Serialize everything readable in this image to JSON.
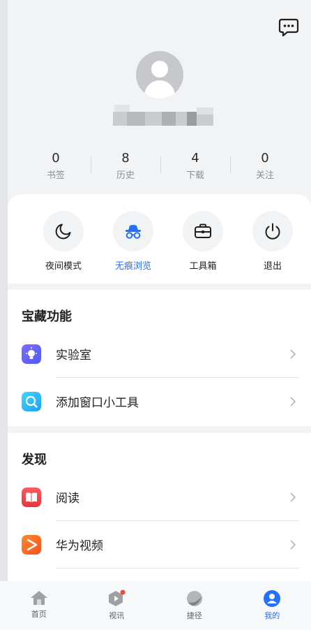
{
  "profile": {
    "stats": [
      {
        "value": "0",
        "label": "书签"
      },
      {
        "value": "8",
        "label": "历史"
      },
      {
        "value": "4",
        "label": "下载"
      },
      {
        "value": "0",
        "label": "关注"
      }
    ]
  },
  "quick_actions": [
    {
      "label": "夜间模式",
      "icon": "moon-icon"
    },
    {
      "label": "无痕浏览",
      "icon": "incognito-icon",
      "active": true
    },
    {
      "label": "工具箱",
      "icon": "toolbox-icon"
    },
    {
      "label": "退出",
      "icon": "power-icon"
    }
  ],
  "treasure": {
    "title": "宝藏功能",
    "items": [
      {
        "label": "实验室",
        "icon": "lab-icon"
      },
      {
        "label": "添加窗口小工具",
        "icon": "widget-icon"
      }
    ]
  },
  "discover": {
    "title": "发现",
    "items": [
      {
        "label": "阅读",
        "icon": "book-icon"
      },
      {
        "label": "华为视频",
        "icon": "video-icon"
      }
    ]
  },
  "tabs": [
    {
      "label": "首页"
    },
    {
      "label": "视讯"
    },
    {
      "label": "捷径"
    },
    {
      "label": "我的",
      "active": true
    }
  ],
  "colors": {
    "accent": "#256fff",
    "badge": "#f04a3e",
    "background": "#f1f3f5"
  }
}
